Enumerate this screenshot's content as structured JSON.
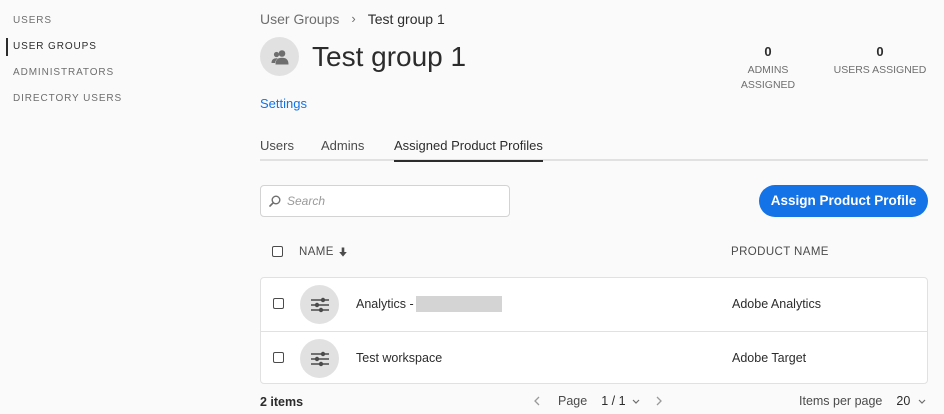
{
  "sidebar": {
    "items": [
      {
        "label": "USERS"
      },
      {
        "label": "USER GROUPS"
      },
      {
        "label": "ADMINISTRATORS"
      },
      {
        "label": "DIRECTORY USERS"
      }
    ]
  },
  "breadcrumb": {
    "parent": "User Groups",
    "separator": "›",
    "current": "Test group 1"
  },
  "header": {
    "title": "Test group 1",
    "stats": [
      {
        "value": "0",
        "label_line1": "ADMINS",
        "label_line2": "ASSIGNED"
      },
      {
        "value": "0",
        "label_line1": "USERS ASSIGNED",
        "label_line2": ""
      }
    ],
    "settings_link": "Settings"
  },
  "tabs": [
    {
      "label": "Users"
    },
    {
      "label": "Admins"
    },
    {
      "label": "Assigned Product Profiles"
    }
  ],
  "search": {
    "placeholder": "Search",
    "value": ""
  },
  "assign_button": "Assign Product Profile",
  "table": {
    "columns": [
      {
        "label": "NAME"
      },
      {
        "label": "PRODUCT NAME"
      }
    ],
    "rows": [
      {
        "name": "Analytics - ",
        "product": "Adobe Analytics"
      },
      {
        "name": "Test workspace",
        "product": "Adobe Target"
      }
    ]
  },
  "footer": {
    "item_count": "2 items",
    "page_label": "Page",
    "page_value": "1 / 1",
    "per_page_label": "Items per page",
    "per_page_value": "20"
  },
  "colors": {
    "accent": "#1473e6",
    "text": "#2c2c2c",
    "muted": "#6e6e6e",
    "icon_bg": "#e1e1e1"
  },
  "icons": {
    "group": "group-icon",
    "profile": "sliders-icon",
    "search": "search-icon",
    "sort": "sort-down-icon"
  }
}
